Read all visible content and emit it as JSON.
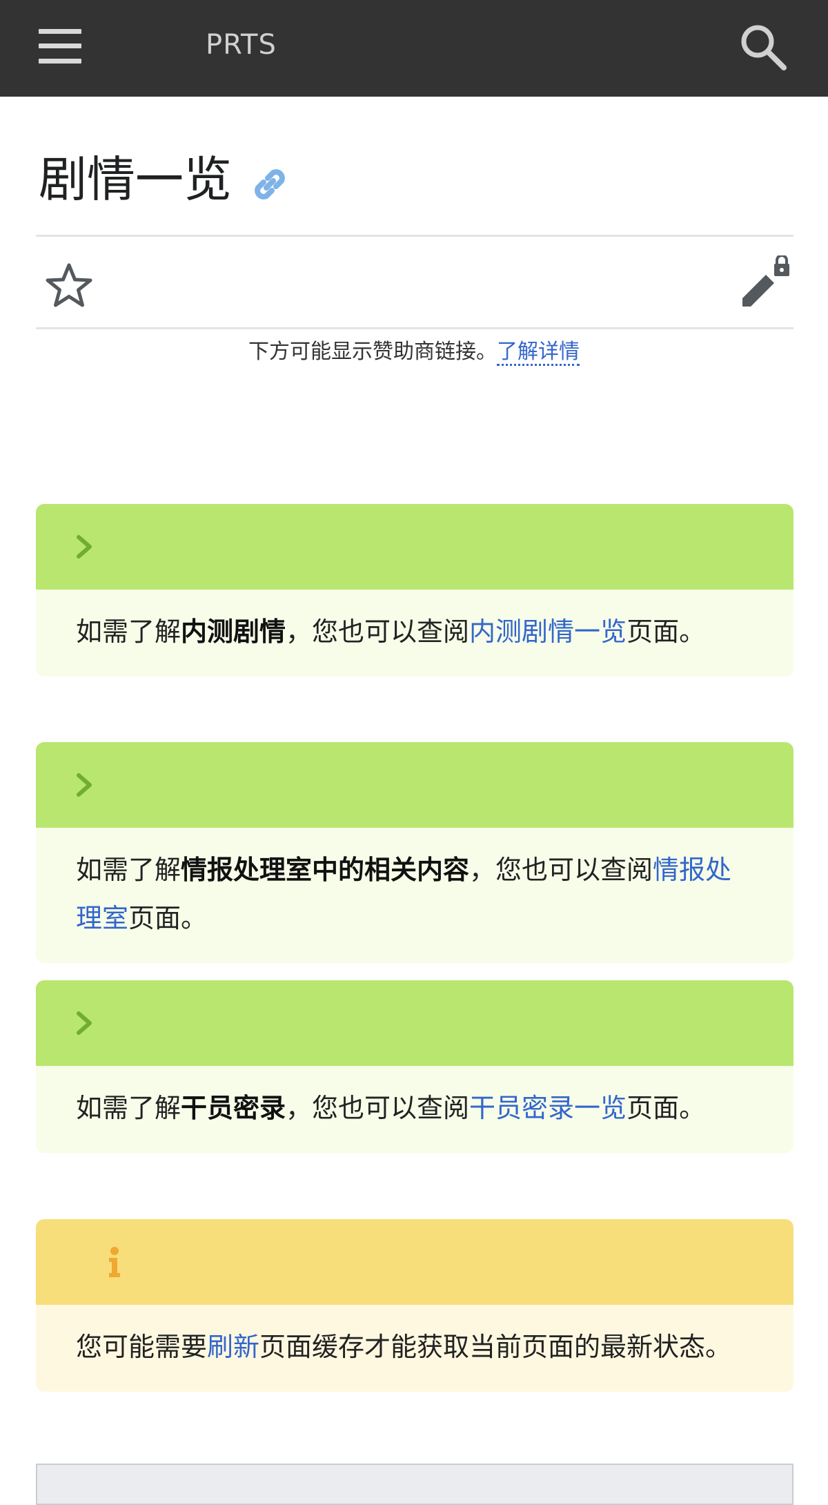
{
  "header": {
    "site_title": "PRTS",
    "menu_icon": "hamburger-menu-icon",
    "search_icon": "search-icon",
    "background_color": "#333333"
  },
  "page": {
    "title": "剧情一览",
    "title_link_icon": "link-icon"
  },
  "actions": {
    "watch_icon": "star-icon",
    "edit_icon": "edit-locked-icon"
  },
  "sponsor": {
    "text": "下方可能显示赞助商链接。",
    "link_label": "了解详情"
  },
  "notices": [
    {
      "kind": "green",
      "prefix": "如需了解",
      "strong": "内测剧情",
      "middle": "，您也可以查阅",
      "link": "内测剧情一览",
      "suffix": "页面。"
    },
    {
      "kind": "green",
      "prefix": "如需了解",
      "strong": "情报处理室中的相关内容",
      "middle": "，您也可以查阅",
      "link": "情报处理室",
      "suffix": "页面。"
    },
    {
      "kind": "green",
      "prefix": "如需了解",
      "strong": "干员密录",
      "middle": "，您也可以查阅",
      "link": "干员密录一览",
      "suffix": "页面。"
    },
    {
      "kind": "yellow",
      "prefix": "您可能需要",
      "link": "刷新",
      "suffix": "页面缓存才能获取当前页面的最新状态。"
    }
  ],
  "colors": {
    "green_head": "#b9e66e",
    "green_body": "#f7fde9",
    "yellow_head": "#f7de7a",
    "yellow_body": "#fef8e1",
    "link": "#3366cc"
  }
}
